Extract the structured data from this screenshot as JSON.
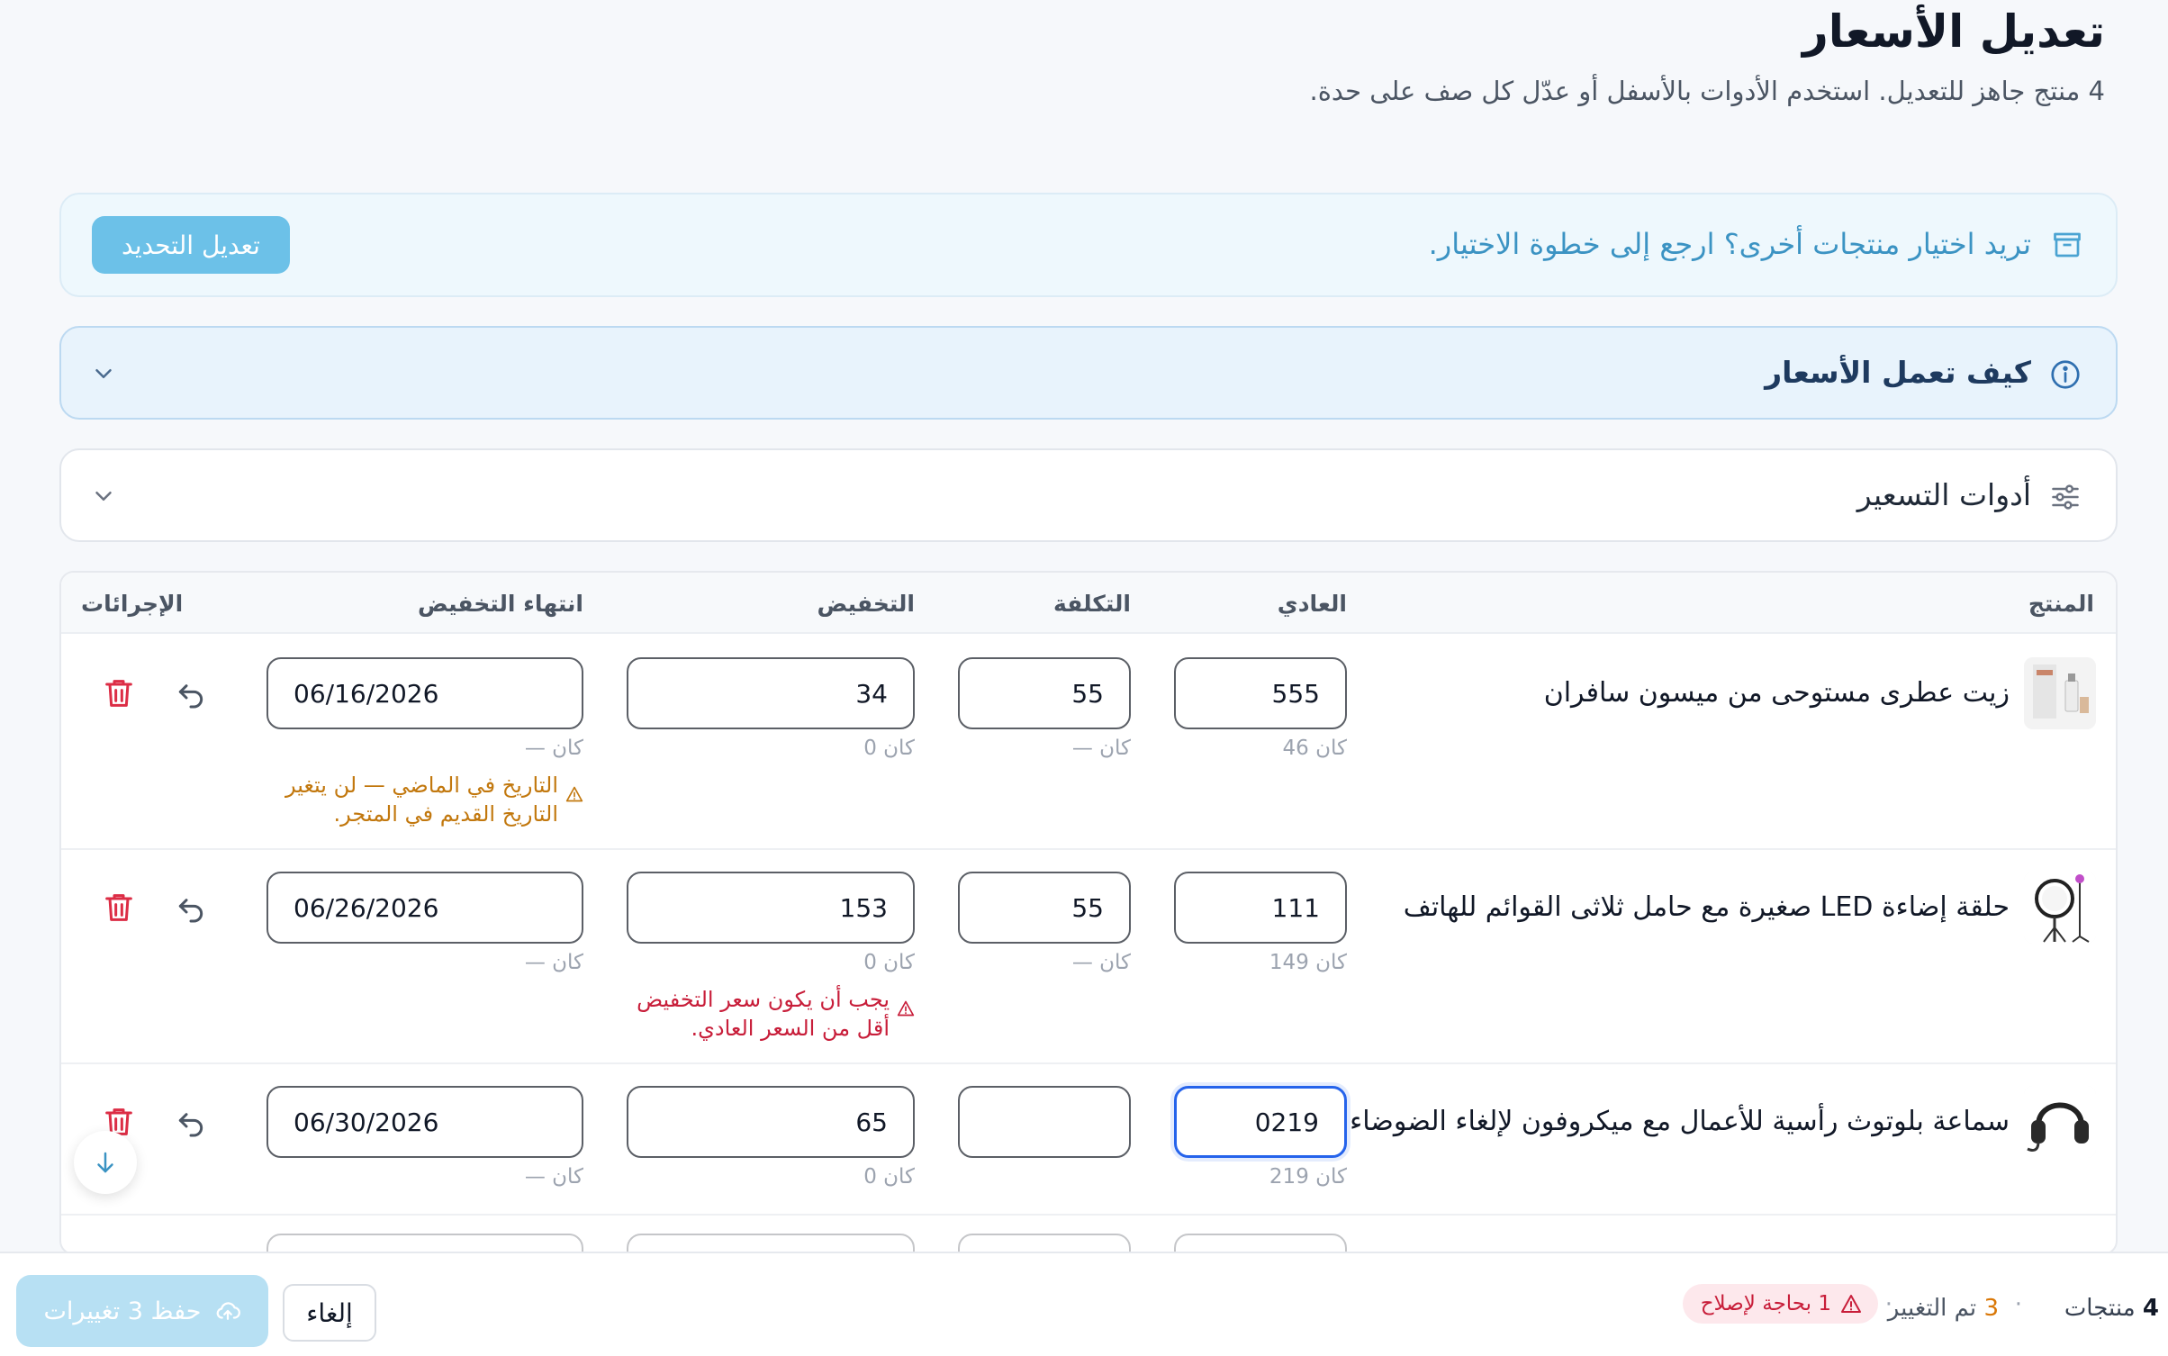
{
  "header": {
    "title": "تعديل الأسعار",
    "subtitle": "4 منتج جاهز للتعديل. استخدم الأدوات بالأسفل أو عدّل كل صف على حدة."
  },
  "banner": {
    "icon": "box-icon",
    "text": "تريد اختيار منتجات أخرى؟ ارجع إلى خطوة الاختيار.",
    "button_label": "تعديل التحديد"
  },
  "accordions": {
    "how": {
      "icon": "info-icon",
      "title": "كيف تعمل الأسعار",
      "expanded": false
    },
    "tools": {
      "icon": "sliders-icon",
      "title": "أدوات التسعير",
      "expanded": false
    }
  },
  "table": {
    "columns": {
      "product": "المنتج",
      "regular": "العادي",
      "cost": "التكلفة",
      "discount": "التخفيض",
      "discount_end": "انتهاء التخفيض",
      "actions": "الإجرائات"
    },
    "rows": [
      {
        "name": "زيت عطرى مستوحى من ميسون سافران",
        "regular": "555",
        "regular_was": "كان 46",
        "cost": "55",
        "cost_was": "كان —",
        "discount": "34",
        "discount_was": "كان 0",
        "end_date": "06/16/2026",
        "end_date_was": "كان —",
        "warning": "التاريخ في الماضي — لن يتغير التاريخ القديم في المتجر."
      },
      {
        "name": "حلقة إضاءة LED صغيرة مع حامل ثلاثى القوائم للهاتف",
        "regular": "111",
        "regular_was": "كان 149",
        "cost": "55",
        "cost_was": "كان —",
        "discount": "153",
        "discount_was": "كان 0",
        "end_date": "06/26/2026",
        "end_date_was": "كان —",
        "error": "يجب أن يكون سعر التخفيض أقل من السعر العادي."
      },
      {
        "name": "سماعة بلوتوث رأسية للأعمال مع ميكروفون لإلغاء الضوضاء",
        "regular": "0219",
        "regular_was": "كان 219",
        "cost": "",
        "cost_was": "",
        "discount": "65",
        "discount_was": "كان 0",
        "end_date": "06/30/2026",
        "end_date_was": "كان —"
      }
    ]
  },
  "footer": {
    "products_count": "4",
    "products_label": "منتجات",
    "changed_count": "3",
    "changed_label": "تم التغيير",
    "needs_fix": "1 بحاجة لإصلاح",
    "cancel_label": "إلغاء",
    "save_label": "حفظ 3 تغييرات"
  },
  "colors": {
    "accent": "#6cc1e8",
    "warning": "#c2780e",
    "error": "#c81e3a",
    "focus": "#2563eb"
  }
}
